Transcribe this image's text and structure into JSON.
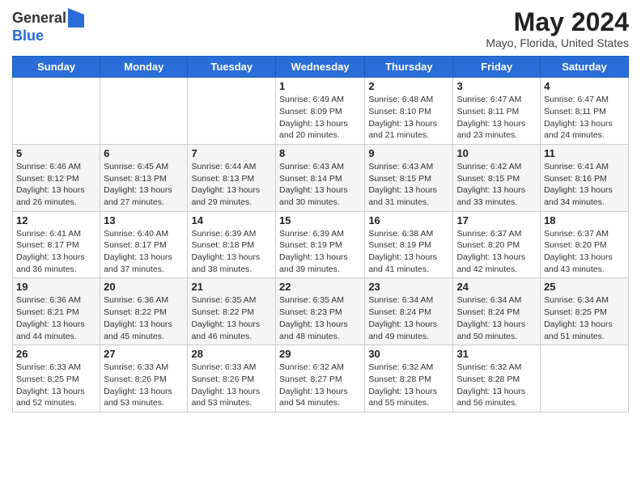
{
  "header": {
    "logo_line1": "General",
    "logo_line2": "Blue",
    "title": "May 2024",
    "location": "Mayo, Florida, United States"
  },
  "days_of_week": [
    "Sunday",
    "Monday",
    "Tuesday",
    "Wednesday",
    "Thursday",
    "Friday",
    "Saturday"
  ],
  "weeks": [
    [
      {
        "day": "",
        "info": ""
      },
      {
        "day": "",
        "info": ""
      },
      {
        "day": "",
        "info": ""
      },
      {
        "day": "1",
        "info": "Sunrise: 6:49 AM\nSunset: 8:09 PM\nDaylight: 13 hours\nand 20 minutes."
      },
      {
        "day": "2",
        "info": "Sunrise: 6:48 AM\nSunset: 8:10 PM\nDaylight: 13 hours\nand 21 minutes."
      },
      {
        "day": "3",
        "info": "Sunrise: 6:47 AM\nSunset: 8:11 PM\nDaylight: 13 hours\nand 23 minutes."
      },
      {
        "day": "4",
        "info": "Sunrise: 6:47 AM\nSunset: 8:11 PM\nDaylight: 13 hours\nand 24 minutes."
      }
    ],
    [
      {
        "day": "5",
        "info": "Sunrise: 6:46 AM\nSunset: 8:12 PM\nDaylight: 13 hours\nand 26 minutes."
      },
      {
        "day": "6",
        "info": "Sunrise: 6:45 AM\nSunset: 8:13 PM\nDaylight: 13 hours\nand 27 minutes."
      },
      {
        "day": "7",
        "info": "Sunrise: 6:44 AM\nSunset: 8:13 PM\nDaylight: 13 hours\nand 29 minutes."
      },
      {
        "day": "8",
        "info": "Sunrise: 6:43 AM\nSunset: 8:14 PM\nDaylight: 13 hours\nand 30 minutes."
      },
      {
        "day": "9",
        "info": "Sunrise: 6:43 AM\nSunset: 8:15 PM\nDaylight: 13 hours\nand 31 minutes."
      },
      {
        "day": "10",
        "info": "Sunrise: 6:42 AM\nSunset: 8:15 PM\nDaylight: 13 hours\nand 33 minutes."
      },
      {
        "day": "11",
        "info": "Sunrise: 6:41 AM\nSunset: 8:16 PM\nDaylight: 13 hours\nand 34 minutes."
      }
    ],
    [
      {
        "day": "12",
        "info": "Sunrise: 6:41 AM\nSunset: 8:17 PM\nDaylight: 13 hours\nand 36 minutes."
      },
      {
        "day": "13",
        "info": "Sunrise: 6:40 AM\nSunset: 8:17 PM\nDaylight: 13 hours\nand 37 minutes."
      },
      {
        "day": "14",
        "info": "Sunrise: 6:39 AM\nSunset: 8:18 PM\nDaylight: 13 hours\nand 38 minutes."
      },
      {
        "day": "15",
        "info": "Sunrise: 6:39 AM\nSunset: 8:19 PM\nDaylight: 13 hours\nand 39 minutes."
      },
      {
        "day": "16",
        "info": "Sunrise: 6:38 AM\nSunset: 8:19 PM\nDaylight: 13 hours\nand 41 minutes."
      },
      {
        "day": "17",
        "info": "Sunrise: 6:37 AM\nSunset: 8:20 PM\nDaylight: 13 hours\nand 42 minutes."
      },
      {
        "day": "18",
        "info": "Sunrise: 6:37 AM\nSunset: 8:20 PM\nDaylight: 13 hours\nand 43 minutes."
      }
    ],
    [
      {
        "day": "19",
        "info": "Sunrise: 6:36 AM\nSunset: 8:21 PM\nDaylight: 13 hours\nand 44 minutes."
      },
      {
        "day": "20",
        "info": "Sunrise: 6:36 AM\nSunset: 8:22 PM\nDaylight: 13 hours\nand 45 minutes."
      },
      {
        "day": "21",
        "info": "Sunrise: 6:35 AM\nSunset: 8:22 PM\nDaylight: 13 hours\nand 46 minutes."
      },
      {
        "day": "22",
        "info": "Sunrise: 6:35 AM\nSunset: 8:23 PM\nDaylight: 13 hours\nand 48 minutes."
      },
      {
        "day": "23",
        "info": "Sunrise: 6:34 AM\nSunset: 8:24 PM\nDaylight: 13 hours\nand 49 minutes."
      },
      {
        "day": "24",
        "info": "Sunrise: 6:34 AM\nSunset: 8:24 PM\nDaylight: 13 hours\nand 50 minutes."
      },
      {
        "day": "25",
        "info": "Sunrise: 6:34 AM\nSunset: 8:25 PM\nDaylight: 13 hours\nand 51 minutes."
      }
    ],
    [
      {
        "day": "26",
        "info": "Sunrise: 6:33 AM\nSunset: 8:25 PM\nDaylight: 13 hours\nand 52 minutes."
      },
      {
        "day": "27",
        "info": "Sunrise: 6:33 AM\nSunset: 8:26 PM\nDaylight: 13 hours\nand 53 minutes."
      },
      {
        "day": "28",
        "info": "Sunrise: 6:33 AM\nSunset: 8:26 PM\nDaylight: 13 hours\nand 53 minutes."
      },
      {
        "day": "29",
        "info": "Sunrise: 6:32 AM\nSunset: 8:27 PM\nDaylight: 13 hours\nand 54 minutes."
      },
      {
        "day": "30",
        "info": "Sunrise: 6:32 AM\nSunset: 8:28 PM\nDaylight: 13 hours\nand 55 minutes."
      },
      {
        "day": "31",
        "info": "Sunrise: 6:32 AM\nSunset: 8:28 PM\nDaylight: 13 hours\nand 56 minutes."
      },
      {
        "day": "",
        "info": ""
      }
    ]
  ]
}
